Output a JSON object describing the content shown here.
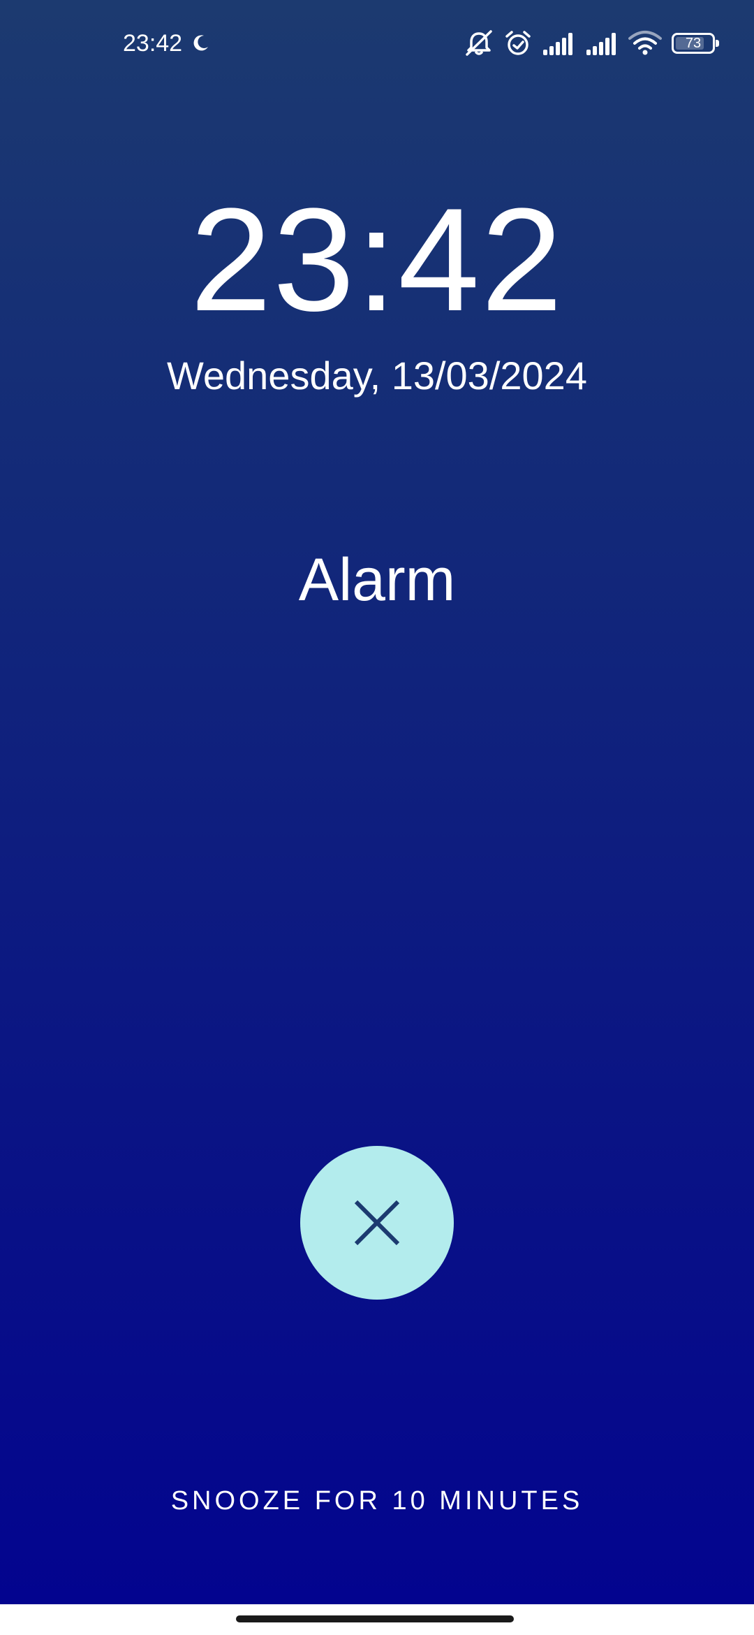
{
  "status_bar": {
    "time": "23:42",
    "battery_level": "73",
    "icons": [
      "moon-icon",
      "silent-bell-icon",
      "alarm-icon",
      "signal-icon",
      "signal-icon",
      "wifi-icon",
      "battery-icon"
    ]
  },
  "alarm": {
    "time": "23:42",
    "date": "Wednesday, 13/03/2024",
    "label": "Alarm",
    "dismiss_icon": "close-icon",
    "snooze_label": "SNOOZE FOR 10 MINUTES"
  },
  "colors": {
    "gradient_top": "#1c3a70",
    "gradient_bottom": "#03048f",
    "dismiss_button": "#b3eced",
    "dismiss_icon": "#1c3a70"
  }
}
